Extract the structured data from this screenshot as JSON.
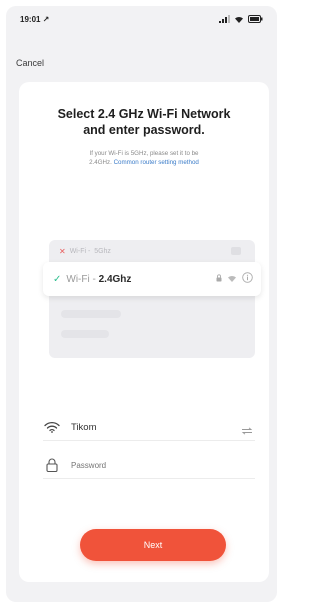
{
  "status_bar": {
    "time": "19:01 ↗"
  },
  "header": {
    "cancel_label": "Cancel"
  },
  "instructions": {
    "title_line1": "Select 2.4 GHz Wi-Fi Network",
    "title_line2": "and enter password.",
    "subtitle_line1": "If your Wi-Fi is 5GHz, please set it to be",
    "subtitle_line2_prefix": "2.4GHz.",
    "router_link": "Common router setting method"
  },
  "wifi_list": {
    "network_5g": {
      "prefix": "Wi-Fi -",
      "band": "5Ghz",
      "status_icon": "cross-icon"
    },
    "network_24": {
      "prefix": "Wi-Fi -",
      "band": "2.4Ghz",
      "status_icon": "check-icon"
    }
  },
  "form": {
    "ssid_value": "Tikom",
    "password_placeholder": "Password"
  },
  "actions": {
    "next_label": "Next"
  },
  "colors": {
    "accent": "#f0533a",
    "link": "#3b7cc9",
    "success": "#2fbf8f",
    "error": "#e85c5c"
  }
}
